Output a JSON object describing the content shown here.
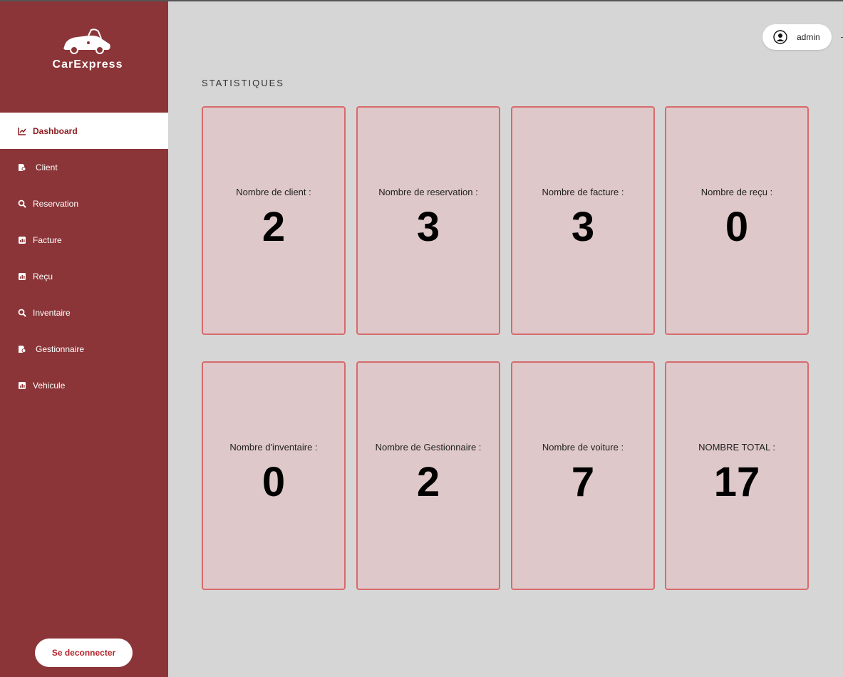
{
  "app": {
    "brand": "CarExpress"
  },
  "colors": {
    "sidebar": "#8b3538",
    "card_bg": "#dfc8c9",
    "card_border": "#d86a6c",
    "accent": "#b3262c"
  },
  "sidebar": {
    "items": [
      {
        "label": "Dashboard",
        "icon": "chart-line-icon",
        "active": true
      },
      {
        "label": "Client",
        "icon": "user-file-icon"
      },
      {
        "label": "Reservation",
        "icon": "search-icon"
      },
      {
        "label": "Facture",
        "icon": "chart-bar-icon"
      },
      {
        "label": "Reçu",
        "icon": "chart-bar-icon"
      },
      {
        "label": "Inventaire",
        "icon": "search-icon"
      },
      {
        "label": "Gestionnaire",
        "icon": "user-file-icon"
      },
      {
        "label": "Vehicule",
        "icon": "chart-bar-icon"
      }
    ],
    "logout_label": "Se deconnecter"
  },
  "header": {
    "user": "admin"
  },
  "main": {
    "title": "STATISTIQUES",
    "stats": [
      {
        "label": "Nombre de client :",
        "value": "2"
      },
      {
        "label": "Nombre de reservation :",
        "value": "3"
      },
      {
        "label": "Nombre de facture :",
        "value": "3"
      },
      {
        "label": "Nombre de reçu :",
        "value": "0"
      },
      {
        "label": "Nombre d'inventaire :",
        "value": "0"
      },
      {
        "label": "Nombre de Gestionnaire :",
        "value": "2"
      },
      {
        "label": "Nombre de voiture :",
        "value": "7"
      },
      {
        "label": "NOMBRE TOTAL :",
        "value": "17"
      }
    ]
  }
}
